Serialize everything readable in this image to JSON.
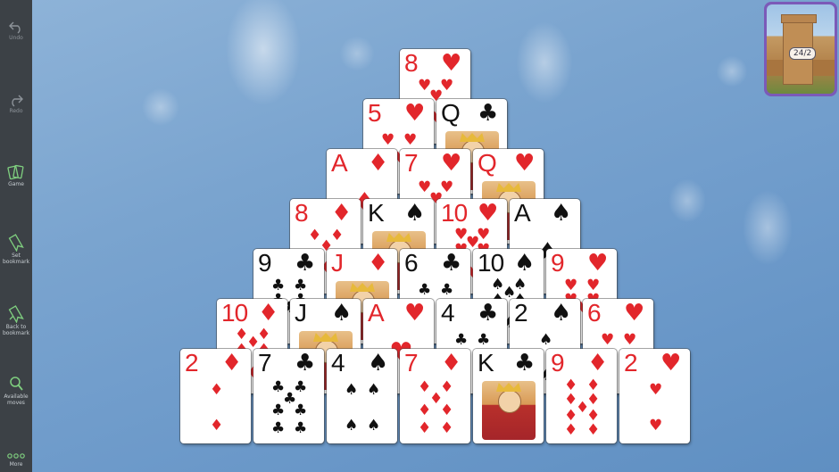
{
  "sidebar": {
    "items": [
      {
        "label": "Undo",
        "icon": "undo-icon",
        "dim": true
      },
      {
        "label": "Redo",
        "icon": "redo-icon",
        "dim": true
      },
      {
        "label": "Game",
        "icon": "cards-icon",
        "dim": false
      },
      {
        "label": "Set bookmark",
        "icon": "bookmark-set-icon",
        "dim": false
      },
      {
        "label": "Back to bookmark",
        "icon": "bookmark-back-icon",
        "dim": false
      },
      {
        "label": "Available moves",
        "icon": "magnifier-icon",
        "dim": false
      },
      {
        "label": "More",
        "icon": "more-dots-icon",
        "dim": false
      }
    ]
  },
  "badge": {
    "text": "24/2"
  },
  "colors": {
    "red_suit": "#e2262b",
    "black_suit": "#111111",
    "sidebar_bg": "#3c4146",
    "badge_border": "#7b5ab8"
  },
  "pyramid": [
    [
      {
        "rank": "8",
        "suit": "♥"
      }
    ],
    [
      {
        "rank": "5",
        "suit": "♥"
      },
      {
        "rank": "Q",
        "suit": "♣"
      }
    ],
    [
      {
        "rank": "A",
        "suit": "♦"
      },
      {
        "rank": "7",
        "suit": "♥"
      },
      {
        "rank": "Q",
        "suit": "♥"
      }
    ],
    [
      {
        "rank": "8",
        "suit": "♦"
      },
      {
        "rank": "K",
        "suit": "♠"
      },
      {
        "rank": "10",
        "suit": "♥"
      },
      {
        "rank": "A",
        "suit": "♠"
      }
    ],
    [
      {
        "rank": "9",
        "suit": "♣"
      },
      {
        "rank": "J",
        "suit": "♦"
      },
      {
        "rank": "6",
        "suit": "♣"
      },
      {
        "rank": "10",
        "suit": "♠"
      },
      {
        "rank": "9",
        "suit": "♥"
      }
    ],
    [
      {
        "rank": "10",
        "suit": "♦"
      },
      {
        "rank": "J",
        "suit": "♠"
      },
      {
        "rank": "A",
        "suit": "♥"
      },
      {
        "rank": "4",
        "suit": "♣"
      },
      {
        "rank": "2",
        "suit": "♠"
      },
      {
        "rank": "6",
        "suit": "♥"
      }
    ],
    [
      {
        "rank": "2",
        "suit": "♦"
      },
      {
        "rank": "7",
        "suit": "♣"
      },
      {
        "rank": "4",
        "suit": "♠"
      },
      {
        "rank": "7",
        "suit": "♦"
      },
      {
        "rank": "K",
        "suit": "♣"
      },
      {
        "rank": "9",
        "suit": "♦"
      },
      {
        "rank": "2",
        "suit": "♥"
      }
    ]
  ]
}
